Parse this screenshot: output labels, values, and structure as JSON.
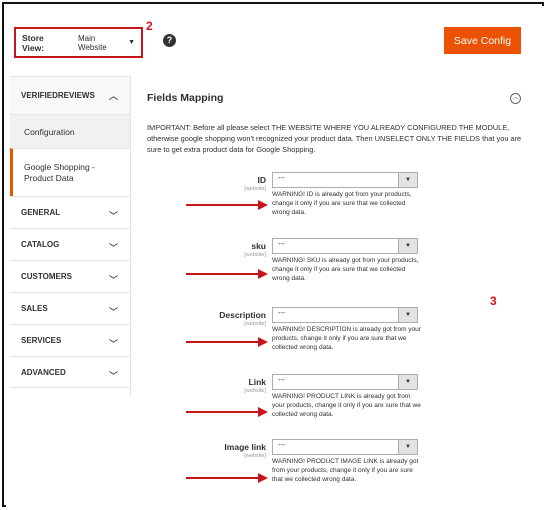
{
  "header": {
    "store_view_label": "Store View:",
    "store_view_value": "Main Website",
    "save_label": "Save Config",
    "annotation_2": "2",
    "annotation_3": "3",
    "help_symbol": "?"
  },
  "sidebar": {
    "section_title": "VERIFIEDREVIEWS",
    "items": [
      {
        "label": "Configuration"
      },
      {
        "label": "Google Shopping - Product Data",
        "active": true
      }
    ],
    "groups": [
      {
        "label": "GENERAL"
      },
      {
        "label": "CATALOG"
      },
      {
        "label": "CUSTOMERS"
      },
      {
        "label": "SALES"
      },
      {
        "label": "SERVICES"
      },
      {
        "label": "ADVANCED"
      }
    ]
  },
  "main": {
    "title": "Fields Mapping",
    "important_text": "IMPORTANT: Before all please select THE WEBSITE WHERE YOU ALREADY CONFIGURED THE MODULE, otherwise google shopping won't recognized your product data. Then UNSELECT ONLY THE FIELDS that you are sure to get extra product data for Google Shopping.",
    "fields": [
      {
        "label": "ID",
        "scope": "[website]",
        "value": "---",
        "note": "WARNING! ID is already got from your products, change it only if you are sure that we collected wrong data."
      },
      {
        "label": "sku",
        "scope": "[website]",
        "value": "---",
        "note": "WARNING! SKU is already got from your products, change it only if you are sure that we collected wrong data."
      },
      {
        "label": "Description",
        "scope": "[website]",
        "value": "---",
        "note": "WARNING! DESCRIPTION is already got from your products, change it only if you are sure that we collected wrong data."
      },
      {
        "label": "Link",
        "scope": "[website]",
        "value": "---",
        "note": "WARNING! PRODUCT LINK is already got from your products, change it only if you are sure that we collected wrong data."
      },
      {
        "label": "Image link",
        "scope": "[website]",
        "value": "---",
        "note": "WARNING! PRODUCT IMAGE LINK is already got from your products, change it only if you are sure that we collected wrong data."
      }
    ]
  },
  "colors": {
    "accent": "#eb5202",
    "annotation_red": "#c4161c"
  }
}
